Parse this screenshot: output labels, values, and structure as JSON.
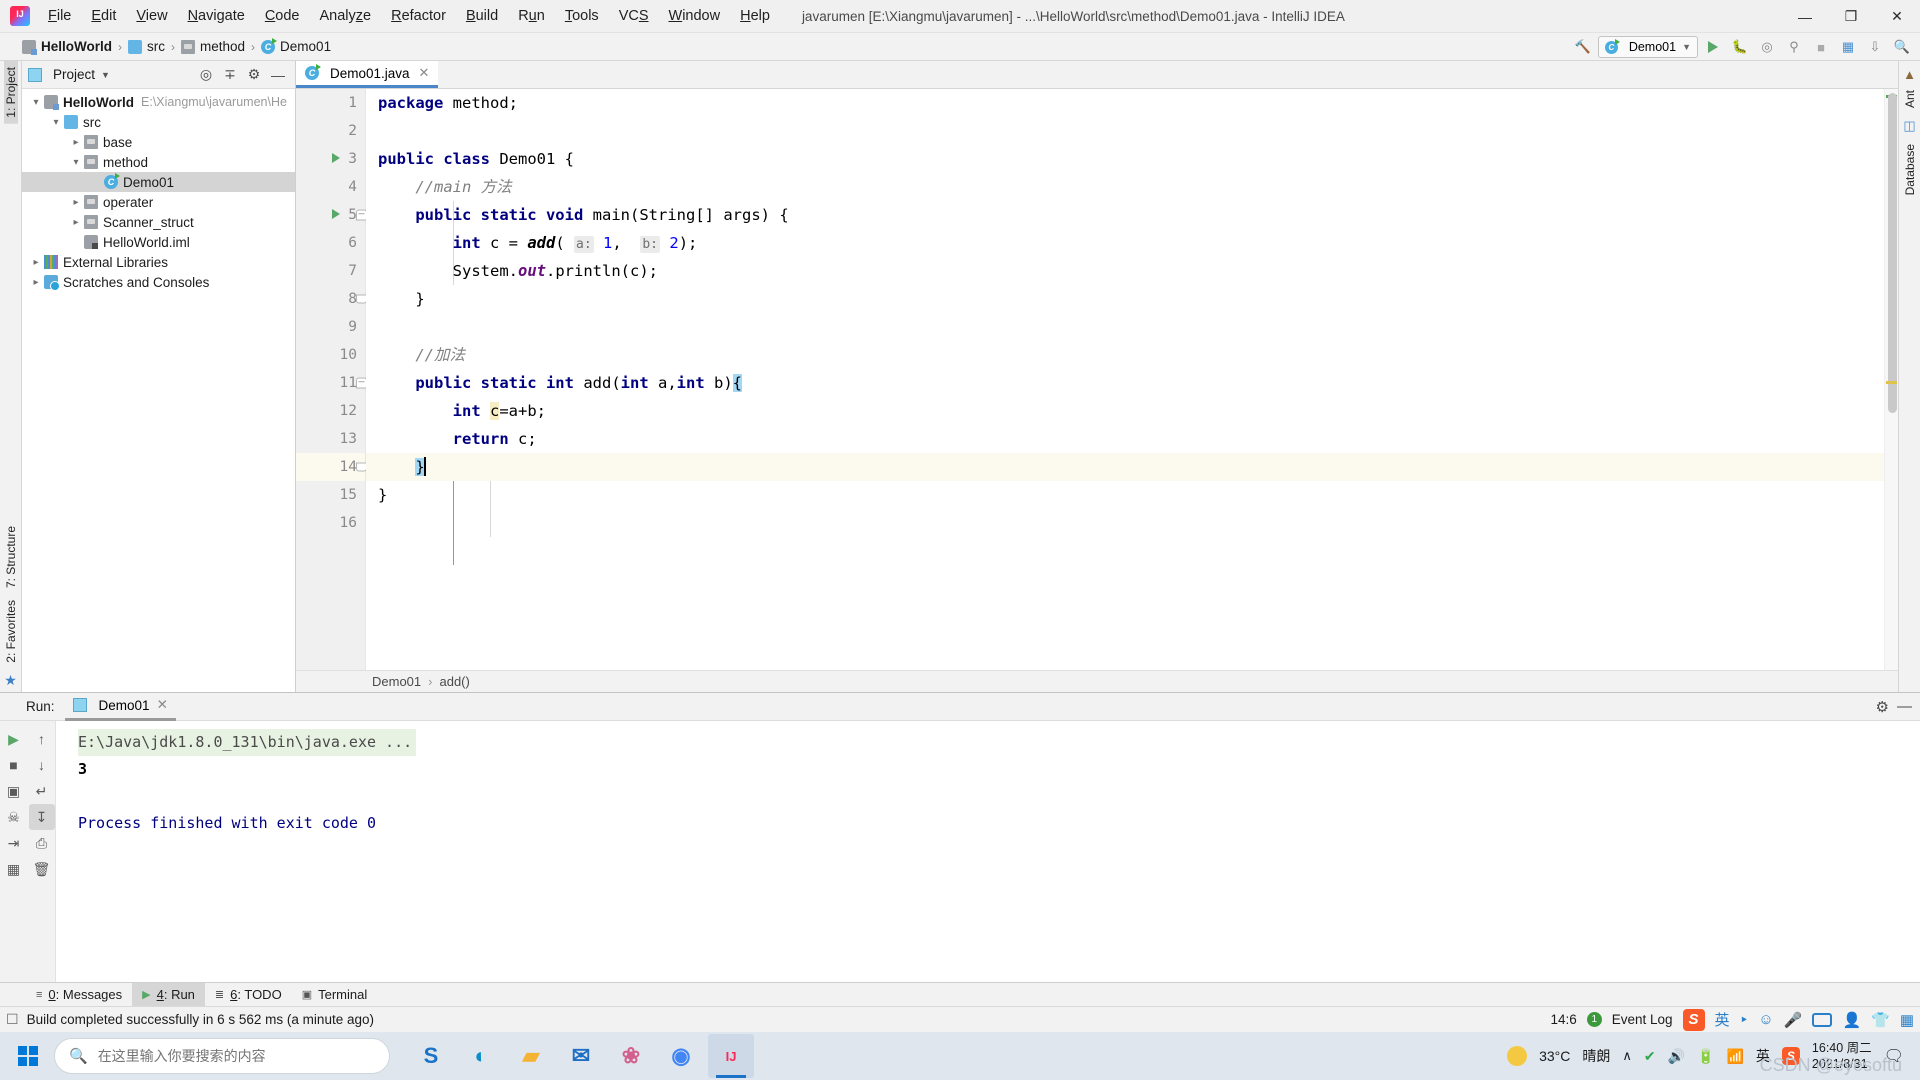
{
  "window": {
    "title": "javarumen [E:\\Xiangmu\\javarumen] - ...\\HelloWorld\\src\\method\\Demo01.java - IntelliJ IDEA",
    "minimize_label": "—",
    "maximize_label": "❐",
    "close_label": "✕",
    "logo_name": "intellij-idea-logo"
  },
  "menu": [
    {
      "label": "File"
    },
    {
      "label": "Edit"
    },
    {
      "label": "View"
    },
    {
      "label": "Navigate"
    },
    {
      "label": "Code"
    },
    {
      "label": "Analyze"
    },
    {
      "label": "Refactor"
    },
    {
      "label": "Build"
    },
    {
      "label": "Run"
    },
    {
      "label": "Tools"
    },
    {
      "label": "VCS"
    },
    {
      "label": "Window"
    },
    {
      "label": "Help"
    }
  ],
  "breadcrumb": [
    {
      "label": "HelloWorld",
      "icon": "module-icon",
      "bold": true
    },
    {
      "label": "src",
      "icon": "folder-icon",
      "bold": false
    },
    {
      "label": "method",
      "icon": "package-icon",
      "bold": false
    },
    {
      "label": "Demo01",
      "icon": "java-class-icon",
      "bold": false
    }
  ],
  "navbar_right": {
    "hammer_icon": "build-hammer-icon",
    "run_config": "Demo01",
    "run_icon": "run-icon",
    "debug_icon": "debug-icon",
    "coverage_icon": "coverage-icon",
    "profile_icon": "profile-icon",
    "stop_icon": "stop-icon",
    "layout_icon": "layout-icon",
    "updates_icon": "updates-icon",
    "search_icon": "search-icon"
  },
  "left_strip": {
    "project_label": "1: Project",
    "structure_label": "7: Structure",
    "favorites_label": "2: Favorites",
    "star_icon": "favorites-star-icon",
    "pin_icon": "pin-icon"
  },
  "right_strip": {
    "ant_label": "Ant",
    "database_label": "Database",
    "maven_icon": "maven-icon"
  },
  "project_panel": {
    "title": "Project",
    "dropdown_icon": "chevron-down-icon",
    "locate_icon": "locate-icon",
    "collapse_icon": "collapse-all-icon",
    "settings_icon": "gear-icon",
    "hide_icon": "hide-icon",
    "tree": [
      {
        "label": "HelloWorld",
        "path": "E:\\Xiangmu\\javarumen\\He",
        "depth": 0,
        "arrow": "open",
        "icon": "module-icon",
        "bold": true,
        "selected": false
      },
      {
        "label": "src",
        "path": "",
        "depth": 1,
        "arrow": "open",
        "icon": "folder-icon",
        "bold": false,
        "selected": false
      },
      {
        "label": "base",
        "path": "",
        "depth": 2,
        "arrow": "closed",
        "icon": "package-icon",
        "bold": false,
        "selected": false
      },
      {
        "label": "method",
        "path": "",
        "depth": 2,
        "arrow": "open",
        "icon": "package-icon",
        "bold": false,
        "selected": false
      },
      {
        "label": "Demo01",
        "path": "",
        "depth": 3,
        "arrow": "none",
        "icon": "java-class-icon",
        "bold": false,
        "selected": true
      },
      {
        "label": "operater",
        "path": "",
        "depth": 2,
        "arrow": "closed",
        "icon": "package-icon",
        "bold": false,
        "selected": false
      },
      {
        "label": "Scanner_struct",
        "path": "",
        "depth": 2,
        "arrow": "closed",
        "icon": "package-icon",
        "bold": false,
        "selected": false
      },
      {
        "label": "HelloWorld.iml",
        "path": "",
        "depth": 2,
        "arrow": "none",
        "icon": "iml-file-icon",
        "bold": false,
        "selected": false
      },
      {
        "label": "External Libraries",
        "path": "",
        "depth": 0,
        "arrow": "closed",
        "icon": "libraries-icon",
        "bold": false,
        "selected": false
      },
      {
        "label": "Scratches and Consoles",
        "path": "",
        "depth": 0,
        "arrow": "closed",
        "icon": "scratches-icon",
        "bold": false,
        "selected": false
      }
    ]
  },
  "editor": {
    "tab": {
      "label": "Demo01.java",
      "icon": "java-class-icon",
      "close_label": "✕"
    },
    "line_count": 16,
    "current_line": 14,
    "lines": [
      {
        "n": 1,
        "run_marker": false,
        "fold": ""
      },
      {
        "n": 2,
        "run_marker": false,
        "fold": ""
      },
      {
        "n": 3,
        "run_marker": true,
        "fold": ""
      },
      {
        "n": 4,
        "run_marker": false,
        "fold": ""
      },
      {
        "n": 5,
        "run_marker": true,
        "fold": "top"
      },
      {
        "n": 6,
        "run_marker": false,
        "fold": ""
      },
      {
        "n": 7,
        "run_marker": false,
        "fold": ""
      },
      {
        "n": 8,
        "run_marker": false,
        "fold": "bottom"
      },
      {
        "n": 9,
        "run_marker": false,
        "fold": ""
      },
      {
        "n": 10,
        "run_marker": false,
        "fold": ""
      },
      {
        "n": 11,
        "run_marker": false,
        "fold": "top"
      },
      {
        "n": 12,
        "run_marker": false,
        "fold": ""
      },
      {
        "n": 13,
        "run_marker": false,
        "fold": ""
      },
      {
        "n": 14,
        "run_marker": false,
        "fold": "bottom"
      },
      {
        "n": 15,
        "run_marker": false,
        "fold": ""
      },
      {
        "n": 16,
        "run_marker": false,
        "fold": ""
      }
    ],
    "code_text": [
      "package method;",
      "",
      "public class Demo01 {",
      "    //main 方法",
      "    public static void main(String[] args) {",
      "        int c = add( a: 1,  b: 2);",
      "        System.out.println(c);",
      "    }",
      "",
      "    //加法",
      "    public static int add(int a,int b){",
      "        int c=a+b;",
      "        return c;",
      "    }",
      "}",
      ""
    ],
    "param_hints": {
      "a": "a:",
      "b": "b:"
    },
    "bottom_breadcrumb": [
      "Demo01",
      "add()"
    ],
    "bottom_breadcrumb_sep": "›"
  },
  "run_panel": {
    "label": "Run:",
    "tab": "Demo01",
    "tab_icon": "run-config-icon",
    "tab_close": "✕",
    "settings_icon": "gear-icon",
    "hide_icon": "hide-icon",
    "toolbar": [
      {
        "name": "rerun-icon",
        "glyph": "▶",
        "active": false
      },
      {
        "name": "up-arrow-icon",
        "glyph": "↑",
        "active": false
      },
      {
        "name": "stop-icon",
        "glyph": "■",
        "active": false
      },
      {
        "name": "down-arrow-icon",
        "glyph": "↓",
        "active": false
      },
      {
        "name": "print-screen-icon",
        "glyph": "▣",
        "active": false
      },
      {
        "name": "soft-wrap-icon",
        "glyph": "↵",
        "active": false
      },
      {
        "name": "kill-process-icon",
        "glyph": "☠",
        "active": false
      },
      {
        "name": "scroll-to-end-icon",
        "glyph": "↧",
        "active": true
      },
      {
        "name": "export-icon",
        "glyph": "⇥",
        "active": false
      },
      {
        "name": "print-icon",
        "glyph": "⎙",
        "active": false
      },
      {
        "name": "grid-icon",
        "glyph": "▦",
        "active": false
      },
      {
        "name": "trash-icon",
        "glyph": "🗑",
        "active": false
      }
    ],
    "console": [
      {
        "text": "E:\\Java\\jdk1.8.0_131\\bin\\java.exe ...",
        "kind": "cmd"
      },
      {
        "text": "3",
        "kind": "out"
      },
      {
        "text": "",
        "kind": "blank"
      },
      {
        "text": "Process finished with exit code 0",
        "kind": "finished"
      }
    ]
  },
  "tool_windows": [
    {
      "label": "0: Messages",
      "underline": "0",
      "icon": "messages-icon",
      "active": false
    },
    {
      "label": "4: Run",
      "underline": "4",
      "icon": "run-icon",
      "active": true
    },
    {
      "label": "6: TODO",
      "underline": "6",
      "icon": "todo-icon",
      "active": false
    },
    {
      "label": "Terminal",
      "underline": "",
      "icon": "terminal-icon",
      "active": false
    }
  ],
  "statusbar": {
    "icon": "build-status-icon",
    "message": "Build completed successfully in 6 s 562 ms (a minute ago)",
    "caret_position": "14:6",
    "event_log": "Event Log",
    "event_count": "1",
    "tray": [
      "sogou-logo-icon",
      "chinese-input-icon",
      "comma-icon",
      "smiley-icon",
      "mic-icon",
      "keyboard-icon",
      "user-icon",
      "shirt-icon",
      "apps-icon"
    ],
    "chinese_label": "英"
  },
  "taskbar": {
    "start_icon": "windows-start-icon",
    "search_placeholder": "在这里输入你要搜索的内容",
    "search_value": "",
    "search_icon": "search-icon",
    "apps": [
      {
        "name": "sogou-app-icon",
        "glyph": "S",
        "active": false,
        "color": "#1a73c8"
      },
      {
        "name": "edge-app-icon",
        "glyph": "◐",
        "active": false,
        "color": "#0b8ec9"
      },
      {
        "name": "file-explorer-app-icon",
        "glyph": "▰",
        "active": false,
        "color": "#f5b336"
      },
      {
        "name": "mail-app-icon",
        "glyph": "✉",
        "active": false,
        "color": "#1e6fc4"
      },
      {
        "name": "photos-app-icon",
        "glyph": "❀",
        "active": false,
        "color": "#d35f8d"
      },
      {
        "name": "chrome-app-icon",
        "glyph": "◉",
        "active": false,
        "color": "#4285f4"
      },
      {
        "name": "intellij-app-icon",
        "glyph": "IJ",
        "active": true,
        "color": "#fe2857"
      }
    ],
    "weather_temp": "33°C",
    "weather_desc": "晴朗",
    "weather_icon": "sun-icon",
    "tray_chevron": "∧",
    "tray": [
      "shield-icon",
      "volume-icon",
      "battery-icon",
      "wifi-icon",
      "ime-icon",
      "sogou-icon"
    ],
    "clock_time": "16:40 周二",
    "clock_date": "2021/8/31",
    "notify_icon": "notifications-icon",
    "watermark": "CSDN @eyesoftu"
  }
}
